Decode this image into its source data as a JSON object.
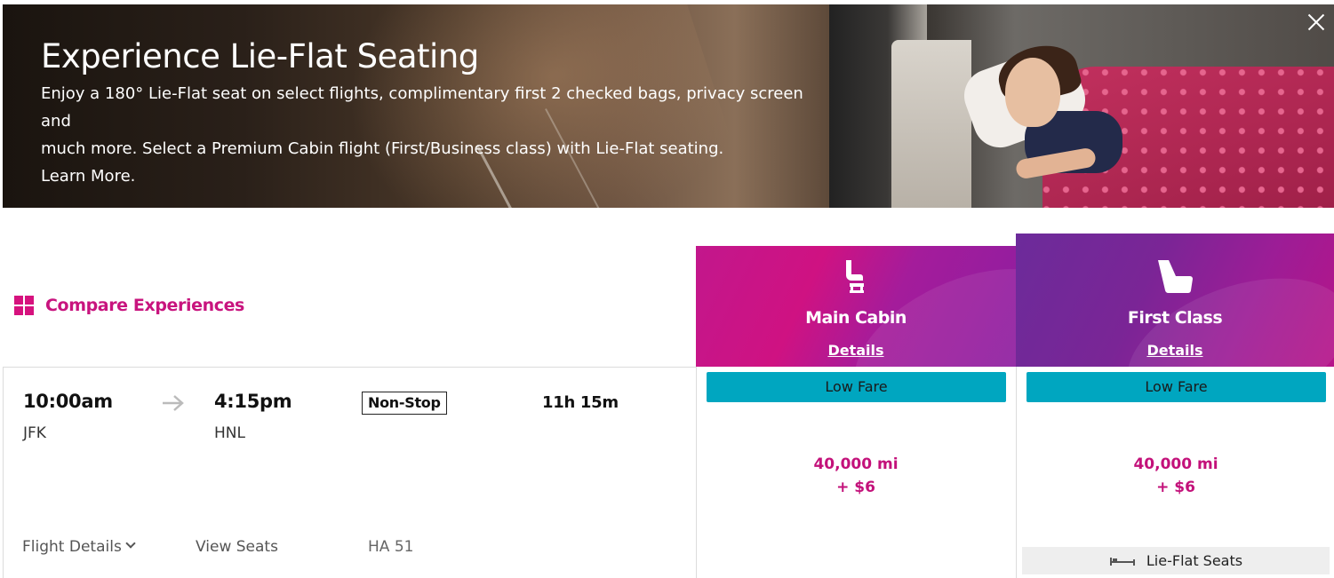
{
  "banner": {
    "title": "Experience Lie-Flat Seating",
    "line1": "Enjoy a 180° Lie-Flat seat on select flights, complimentary first 2 checked bags, privacy screen and",
    "line2": "much more. Select a Premium Cabin flight (First/Business class) with Lie-Flat seating.",
    "learn_more": "Learn More.",
    "close_icon": "close-icon"
  },
  "compare": {
    "label": "Compare Experiences",
    "icon": "grid-icon"
  },
  "cabins": [
    {
      "name": "Main Cabin",
      "details": "Details",
      "icon": "seat-icon"
    },
    {
      "name": "First Class",
      "details": "Details",
      "icon": "lie-flat-seat-icon"
    }
  ],
  "flight": {
    "depart_time": "10:00am",
    "depart_airport": "JFK",
    "arrive_time": "4:15pm",
    "arrive_airport": "HNL",
    "stops": "Non-Stop",
    "duration": "11h 15m",
    "flight_details": "Flight Details",
    "view_seats": "View Seats",
    "flight_number": "HA 51"
  },
  "fares": [
    {
      "badge": "Low Fare",
      "miles": "40,000 mi",
      "cash": "+ $6"
    },
    {
      "badge": "Low Fare",
      "miles": "40,000 mi",
      "cash": "+ $6",
      "amenity": "Lie-Flat Seats"
    }
  ],
  "colors": {
    "accent_magenta": "#c8147e",
    "badge_teal": "#00a6c0",
    "main_cabin_header": "#c2178c",
    "first_class_header": "#7a2596"
  }
}
